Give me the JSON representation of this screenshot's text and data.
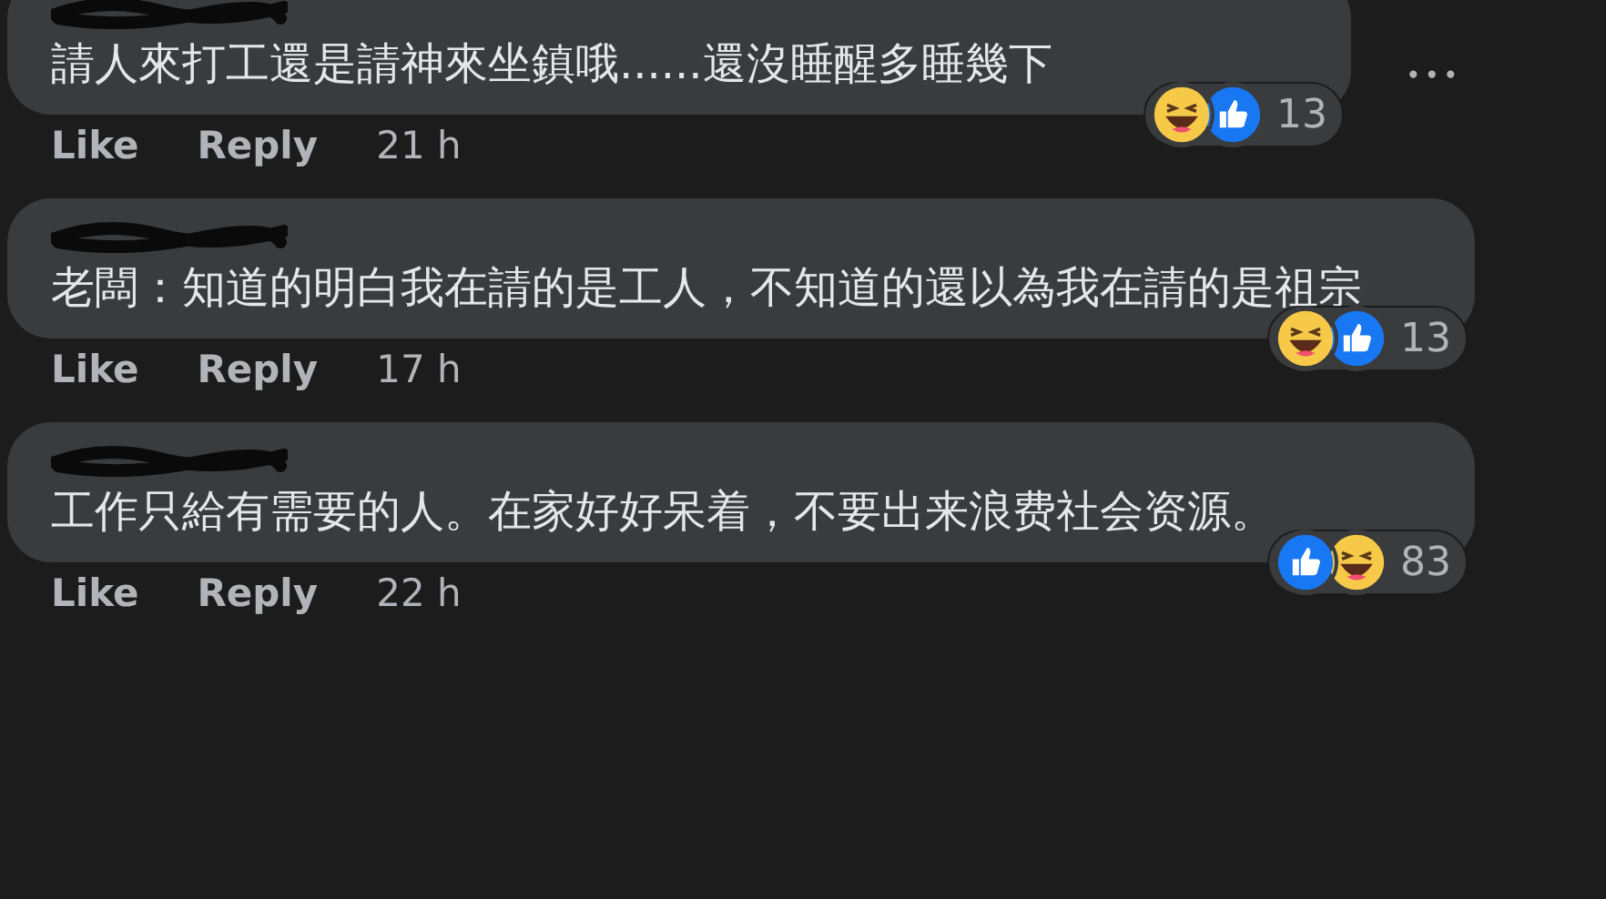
{
  "comments": [
    {
      "text": "請人來打工還是請神來坐鎮哦......還沒睡醒多睡幾下",
      "reactions": [
        {
          "kind": "haha"
        },
        {
          "kind": "like"
        }
      ],
      "reaction_count": "13",
      "actions": [
        "Like",
        "Reply"
      ],
      "time": "21 h",
      "menu": "•••"
    },
    {
      "text": "老闆：知道的明白我在請的是工人，不知道的還以為我在請的是祖宗",
      "reactions": [
        {
          "kind": "haha"
        },
        {
          "kind": "like"
        }
      ],
      "reaction_count": "13",
      "actions": [
        "Like",
        "Reply"
      ],
      "time": "17 h"
    },
    {
      "text": "工作只給有需要的人。在家好好呆着，不要出来浪费社会资源。",
      "reactions": [
        {
          "kind": "like"
        },
        {
          "kind": "haha"
        }
      ],
      "reaction_count": "83",
      "actions": [
        "Like",
        "Reply"
      ],
      "time": "22 h"
    }
  ]
}
